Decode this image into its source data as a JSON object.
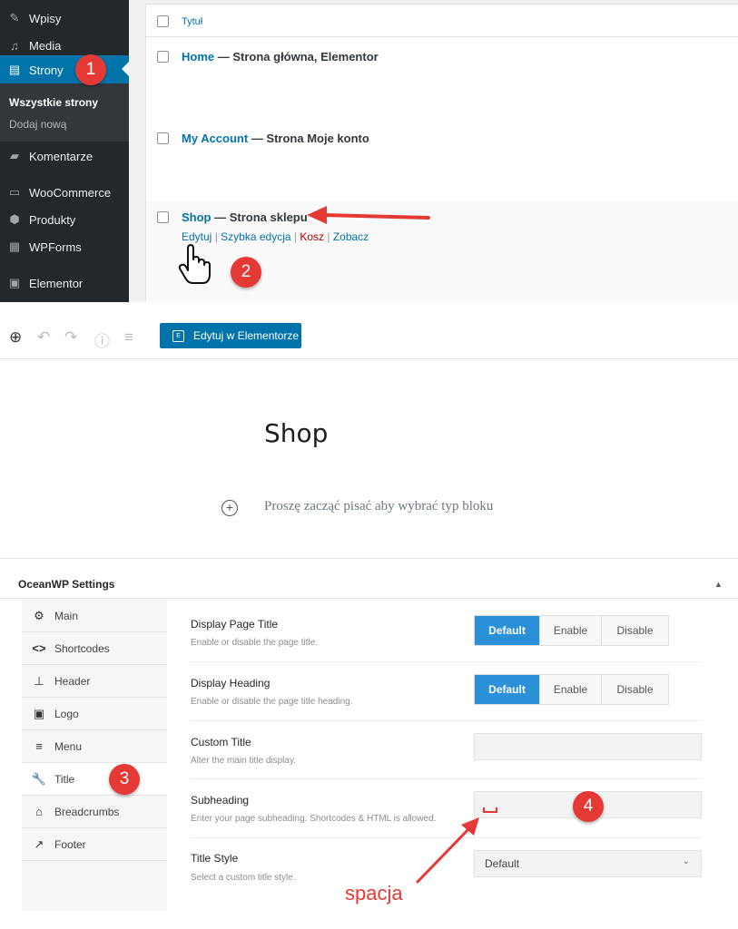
{
  "wp_admin": {
    "menu": [
      {
        "label": "Wpisy",
        "icon": "pin-icon"
      },
      {
        "label": "Media",
        "icon": "media-icon"
      },
      {
        "label": "Strony",
        "icon": "pages-icon"
      },
      {
        "label": "Komentarze",
        "icon": "comments-icon"
      },
      {
        "label": "WooCommerce",
        "icon": "woocommerce-icon"
      },
      {
        "label": "Produkty",
        "icon": "products-icon"
      },
      {
        "label": "WPForms",
        "icon": "wpforms-icon"
      },
      {
        "label": "Elementor",
        "icon": "elementor-icon"
      }
    ],
    "submenu": {
      "current": "Wszystkie strony",
      "add_new": "Dodaj nową"
    },
    "table": {
      "column_title": "Tytuł",
      "rows": [
        {
          "title": "Home",
          "state": " — Strona główna, Elementor"
        },
        {
          "title": "My Account",
          "state": " — Strona Moje konto"
        },
        {
          "title": "Shop",
          "state": " — Strona sklepu"
        }
      ],
      "row_actions": {
        "edit": "Edytuj",
        "quick_edit": "Szybka edycja",
        "trash": "Kosz",
        "view": "Zobacz",
        "sep": " | "
      }
    }
  },
  "editor": {
    "edit_elementor_label": "Edytuj w Elementorze",
    "post_title": "Shop",
    "block_hint": "Proszę zacząć pisać aby wybrać typ bloku"
  },
  "oceanwp": {
    "title": "OceanWP Settings",
    "tabs": [
      {
        "label": "Main",
        "icon": "gear-icon"
      },
      {
        "label": "Shortcodes",
        "icon": "code-icon"
      },
      {
        "label": "Header",
        "icon": "pin-icon"
      },
      {
        "label": "Logo",
        "icon": "image-icon"
      },
      {
        "label": "Menu",
        "icon": "hamburger-icon"
      },
      {
        "label": "Title",
        "icon": "wrench-icon"
      },
      {
        "label": "Breadcrumbs",
        "icon": "home-icon"
      },
      {
        "label": "Footer",
        "icon": "brush-icon"
      }
    ],
    "fields": {
      "display_page_title": {
        "label": "Display Page Title",
        "desc": "Enable or disable the page title."
      },
      "display_heading": {
        "label": "Display Heading",
        "desc": "Enable or disable the page title heading."
      },
      "custom_title": {
        "label": "Custom Title",
        "desc": "Alter the main title display."
      },
      "subheading": {
        "label": "Subheading",
        "desc": "Enter your page subheading. Shortcodes & HTML is allowed."
      },
      "title_style": {
        "label": "Title Style",
        "desc": "Select a custom title style.",
        "value": "Default"
      }
    },
    "toggle_options": {
      "default": "Default",
      "enable": "Enable",
      "disable": "Disable"
    }
  },
  "annotations": {
    "steps": [
      "1",
      "2",
      "3",
      "4"
    ],
    "space_label": "spacja",
    "badge_color": "#e53935"
  }
}
